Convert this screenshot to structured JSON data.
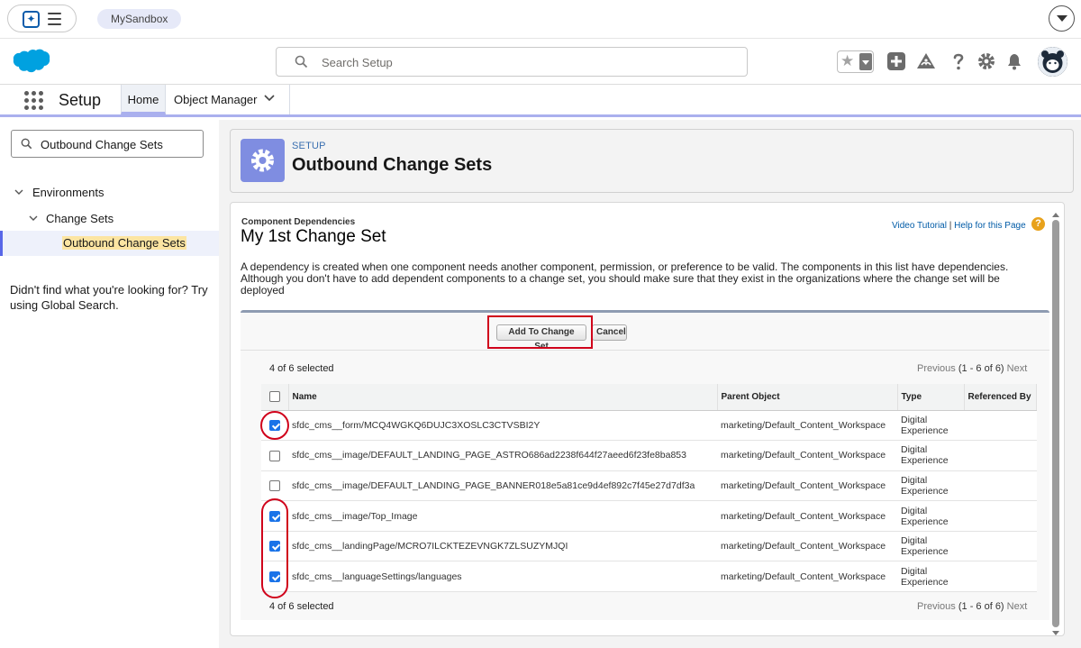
{
  "topbar": {
    "org_name": "MySandbox"
  },
  "header": {
    "search_placeholder": "Search Setup"
  },
  "context": {
    "app_name": "Setup",
    "tabs": [
      {
        "label": "Home"
      },
      {
        "label": "Object Manager"
      }
    ]
  },
  "sidebar": {
    "quickfind_value": "Outbound Change Sets",
    "tree": [
      {
        "label": "Environments"
      },
      {
        "label": "Change Sets"
      },
      {
        "label": "Outbound Change Sets"
      }
    ],
    "hint": "Didn't find what you're looking for? Try using Global Search."
  },
  "page_header": {
    "kicker": "SETUP",
    "title": "Outbound Change Sets"
  },
  "content": {
    "section_label": "Component Dependencies",
    "changeset_name": "My 1st Change Set",
    "video_link": "Video Tutorial",
    "help_separator": "|",
    "help_link": "Help for this Page",
    "description": "A dependency is created when one component needs another component, permission, or preference to be valid. The components in this list have dependencies. Although you don't have to add dependent components to a change set, you should make sure that they exist in the organizations where the change set will be deployed",
    "buttons": {
      "add": "Add To Change Set",
      "cancel": "Cancel"
    },
    "selected_count": "4 of 6 selected",
    "pager": {
      "previous": "Previous",
      "range": "(1 - 6 of 6)",
      "next": "Next"
    },
    "columns": [
      "Name",
      "Parent Object",
      "Type",
      "Referenced By"
    ],
    "rows": [
      {
        "checked": true,
        "name": "sfdc_cms__form/MCQ4WGKQ6DUJC3XOSLC3CTVSBI2Y",
        "parent": "marketing/Default_Content_Workspace",
        "type": "Digital Experience",
        "referenced_by": ""
      },
      {
        "checked": false,
        "name": "sfdc_cms__image/DEFAULT_LANDING_PAGE_ASTRO686ad2238f644f27aeed6f23fe8ba853",
        "parent": "marketing/Default_Content_Workspace",
        "type": "Digital Experience",
        "referenced_by": ""
      },
      {
        "checked": false,
        "name": "sfdc_cms__image/DEFAULT_LANDING_PAGE_BANNER018e5a81ce9d4ef892c7f45e27d7df3a",
        "parent": "marketing/Default_Content_Workspace",
        "type": "Digital Experience",
        "referenced_by": ""
      },
      {
        "checked": true,
        "name": "sfdc_cms__image/Top_Image",
        "parent": "marketing/Default_Content_Workspace",
        "type": "Digital Experience",
        "referenced_by": ""
      },
      {
        "checked": true,
        "name": "sfdc_cms__landingPage/MCRO7ILCKTEZEVNGK7ZLSUZYMJQI",
        "parent": "marketing/Default_Content_Workspace",
        "type": "Digital Experience",
        "referenced_by": ""
      },
      {
        "checked": true,
        "name": "sfdc_cms__languageSettings/languages",
        "parent": "marketing/Default_Content_Workspace",
        "type": "Digital Experience",
        "referenced_by": ""
      }
    ]
  },
  "colors": {
    "accent": "#5867e8",
    "highlight": "#d0021b",
    "brand": "#00a1e0"
  }
}
